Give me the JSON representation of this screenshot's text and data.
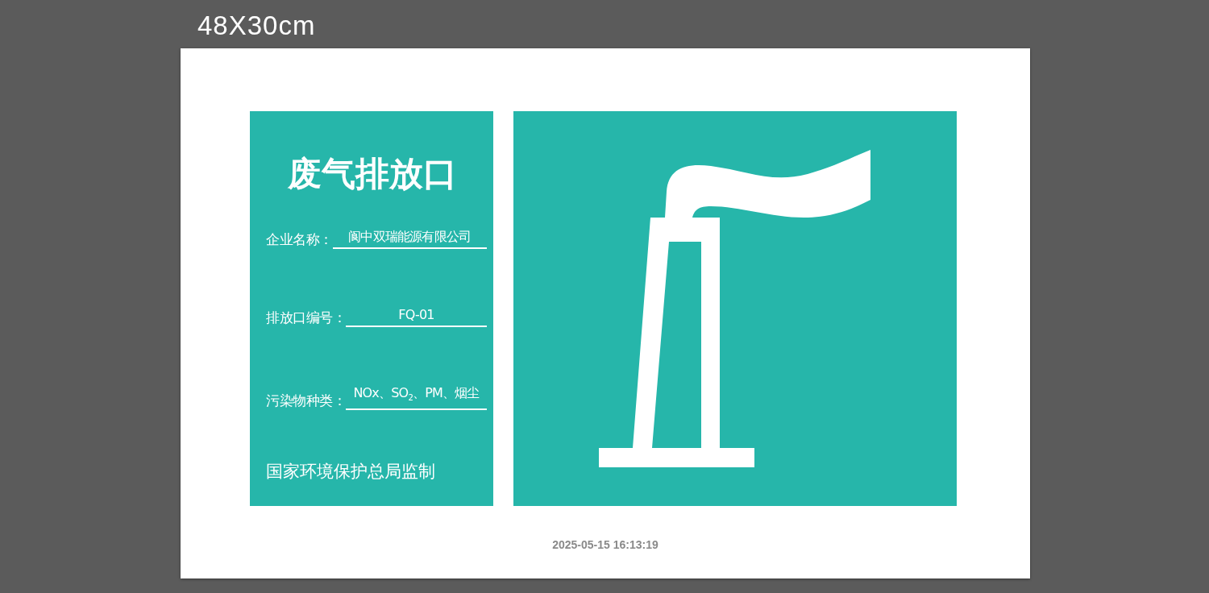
{
  "size_label": "48X30cm",
  "sign": {
    "title": "废气排放口",
    "fields": [
      {
        "label": "企业名称：",
        "value": "阆中双瑞能源有限公司"
      },
      {
        "label": "排放口编号：",
        "value": "FQ-01"
      },
      {
        "label": "污染物种类：",
        "value": "NOx、SO$_{2}$、PM、烟尘"
      }
    ],
    "footer": "国家环境保护总局监制"
  },
  "timestamp": "2025-05-15 16:13:19"
}
